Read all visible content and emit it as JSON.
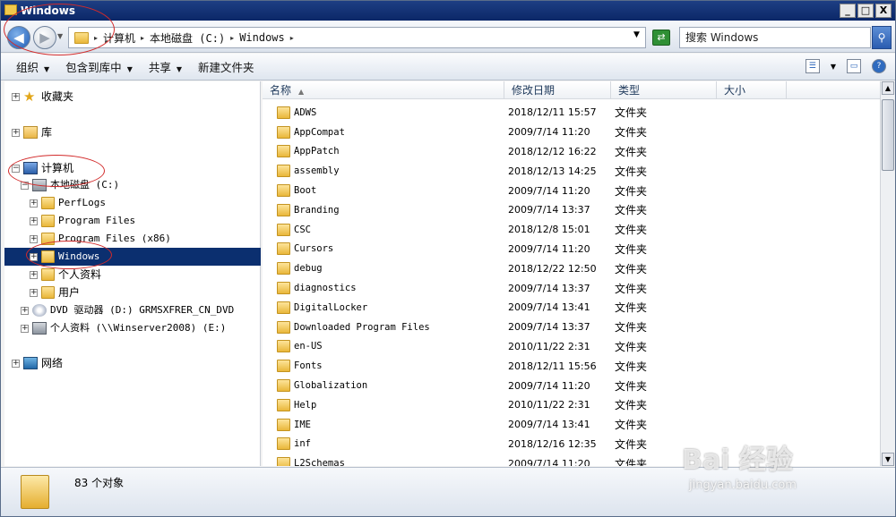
{
  "window": {
    "title": "Windows",
    "min": "_",
    "max": "□",
    "close": "X"
  },
  "address": {
    "crumbs": [
      "计算机",
      "本地磁盘 (C:)",
      "Windows"
    ],
    "search_placeholder": "搜索 Windows"
  },
  "toolbar": {
    "items": [
      "组织",
      "包含到库中",
      "共享",
      "新建文件夹"
    ]
  },
  "tree": {
    "favorites": "收藏夹",
    "libraries": "库",
    "computer": "计算机",
    "local_disk": "本地磁盘 (C:)",
    "perflogs": "PerfLogs",
    "program_files": "Program Files",
    "program_files_x86": "Program Files (x86)",
    "windows": "Windows",
    "personal": "个人资料",
    "users": "用户",
    "dvd": "DVD 驱动器 (D:) GRMSXFRER_CN_DVD",
    "network_share": "个人资料 (\\\\Winserver2008) (E:)",
    "network": "网络"
  },
  "columns": {
    "name": "名称",
    "date": "修改日期",
    "type": "类型",
    "size": "大小"
  },
  "files": [
    {
      "name": "ADWS",
      "date": "2018/12/11 15:57",
      "type": "文件夹"
    },
    {
      "name": "AppCompat",
      "date": "2009/7/14 11:20",
      "type": "文件夹"
    },
    {
      "name": "AppPatch",
      "date": "2018/12/12 16:22",
      "type": "文件夹"
    },
    {
      "name": "assembly",
      "date": "2018/12/13 14:25",
      "type": "文件夹"
    },
    {
      "name": "Boot",
      "date": "2009/7/14 11:20",
      "type": "文件夹"
    },
    {
      "name": "Branding",
      "date": "2009/7/14 13:37",
      "type": "文件夹"
    },
    {
      "name": "CSC",
      "date": "2018/12/8 15:01",
      "type": "文件夹"
    },
    {
      "name": "Cursors",
      "date": "2009/7/14 11:20",
      "type": "文件夹"
    },
    {
      "name": "debug",
      "date": "2018/12/22 12:50",
      "type": "文件夹"
    },
    {
      "name": "diagnostics",
      "date": "2009/7/14 13:37",
      "type": "文件夹"
    },
    {
      "name": "DigitalLocker",
      "date": "2009/7/14 13:41",
      "type": "文件夹"
    },
    {
      "name": "Downloaded Program Files",
      "date": "2009/7/14 13:37",
      "type": "文件夹"
    },
    {
      "name": "en-US",
      "date": "2010/11/22 2:31",
      "type": "文件夹"
    },
    {
      "name": "Fonts",
      "date": "2018/12/11 15:56",
      "type": "文件夹"
    },
    {
      "name": "Globalization",
      "date": "2009/7/14 11:20",
      "type": "文件夹"
    },
    {
      "name": "Help",
      "date": "2010/11/22 2:31",
      "type": "文件夹"
    },
    {
      "name": "IME",
      "date": "2009/7/14 13:41",
      "type": "文件夹"
    },
    {
      "name": "inf",
      "date": "2018/12/16 12:35",
      "type": "文件夹"
    },
    {
      "name": "L2Schemas",
      "date": "2009/7/14 11:20",
      "type": "文件夹"
    }
  ],
  "status": {
    "count": "83 个对象"
  },
  "watermark": {
    "brand": "Bai 经验",
    "url": "jingyan.baidu.com"
  }
}
